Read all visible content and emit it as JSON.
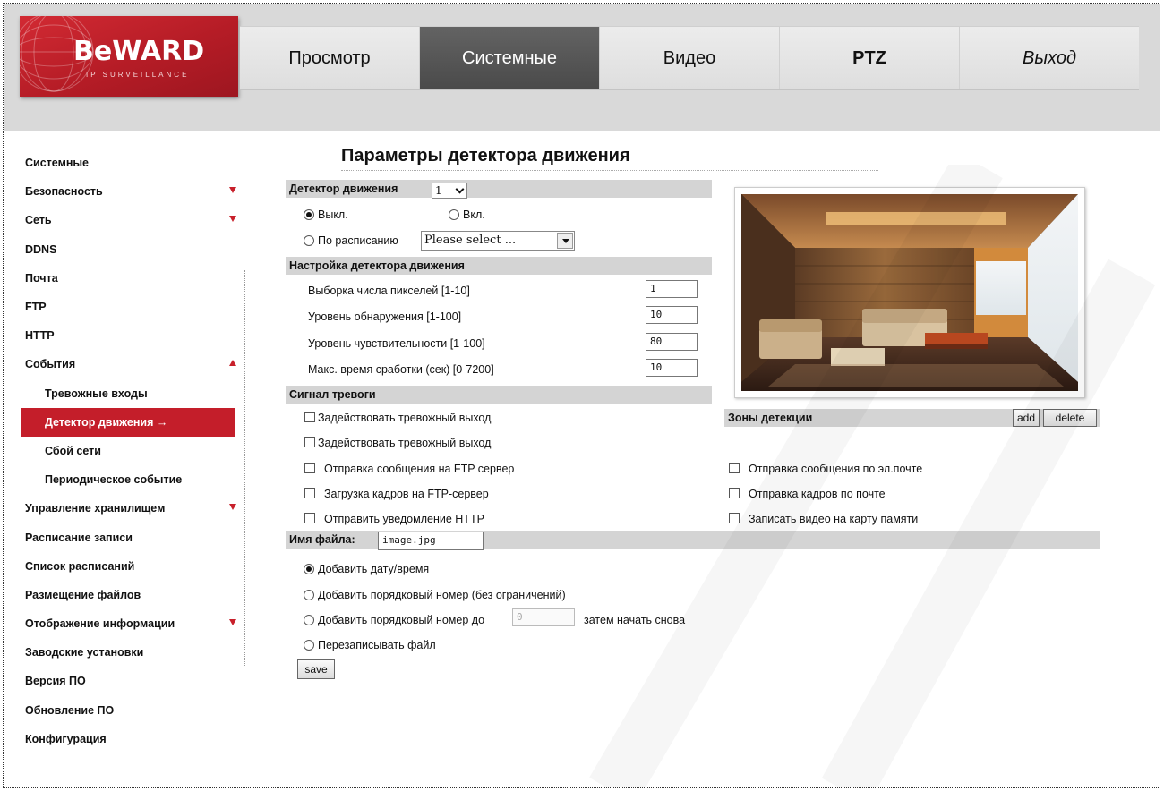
{
  "logo": {
    "main": "BeWARD",
    "sub": "IP SURVEILLANCE"
  },
  "nav": [
    {
      "label": "Просмотр"
    },
    {
      "label": "Системные"
    },
    {
      "label": "Видео"
    },
    {
      "label": "PTZ"
    },
    {
      "label": "Выход"
    }
  ],
  "sidebar": {
    "items": [
      {
        "label": "Системные"
      },
      {
        "label": "Безопасность"
      },
      {
        "label": "Сеть"
      },
      {
        "label": "DDNS"
      },
      {
        "label": "Почта"
      },
      {
        "label": "FTP"
      },
      {
        "label": "HTTP"
      },
      {
        "label": "События"
      },
      {
        "label": "Тревожные входы"
      },
      {
        "label": "Детектор движения →"
      },
      {
        "label": "Сбой сети"
      },
      {
        "label": "Периодическое событие"
      },
      {
        "label": "Управление хранилищем"
      },
      {
        "label": "Расписание записи"
      },
      {
        "label": "Список расписаний"
      },
      {
        "label": "Размещение файлов"
      },
      {
        "label": "Отображение информации"
      },
      {
        "label": "Заводские установки"
      },
      {
        "label": "Версия ПО"
      },
      {
        "label": "Обновление ПО"
      },
      {
        "label": "Конфигурация"
      }
    ]
  },
  "main": {
    "title": "Параметры детектора движения",
    "detector": {
      "label": "Детектор движения",
      "selected": "1",
      "off_label": "Выкл.",
      "on_label": "Вкл.",
      "schedule_label": "По расписанию",
      "schedule_value": "Please select ..."
    },
    "settings": {
      "header": "Настройка детектора движения",
      "rows": [
        {
          "label": "Выборка числа пикселей [1-10]",
          "value": "1"
        },
        {
          "label": "Уровень обнаружения [1-100]",
          "value": "10"
        },
        {
          "label": "Уровень чувствительности [1-100]",
          "value": "80"
        },
        {
          "label": "Макс. время сработки (сек) [0-7200]",
          "value": "10"
        }
      ]
    },
    "zones": {
      "label": "Зоны детекции",
      "add": "add",
      "delete": "delete"
    },
    "alarm": {
      "header": "Сигнал тревоги",
      "left": [
        "Задействовать тревожный выход",
        "Задействовать тревожный выход",
        "Отправка сообщения на FTP сервер",
        "Загрузка кадров на FTP-сервер",
        "Отправить уведомление HTTP"
      ],
      "right": [
        "Отправка сообщения по эл.почте",
        "Отправка кадров по почте",
        "Записать видео на карту памяти"
      ]
    },
    "filename": {
      "label": "Имя файла:",
      "value": "image.jpg",
      "opt_date": "Добавить дату/время",
      "opt_seq": "Добавить порядковый номер (без ограничений)",
      "opt_seq_to": "Добавить порядковый номер до",
      "seq_to_value": "0",
      "opt_seq_to_suffix": "затем начать снова",
      "opt_overwrite": "Перезаписывать файл"
    },
    "save": "save"
  },
  "colors": {
    "accent": "#c41e2a",
    "nav_active": "#555555",
    "section_bar": "#d4d4d4"
  }
}
